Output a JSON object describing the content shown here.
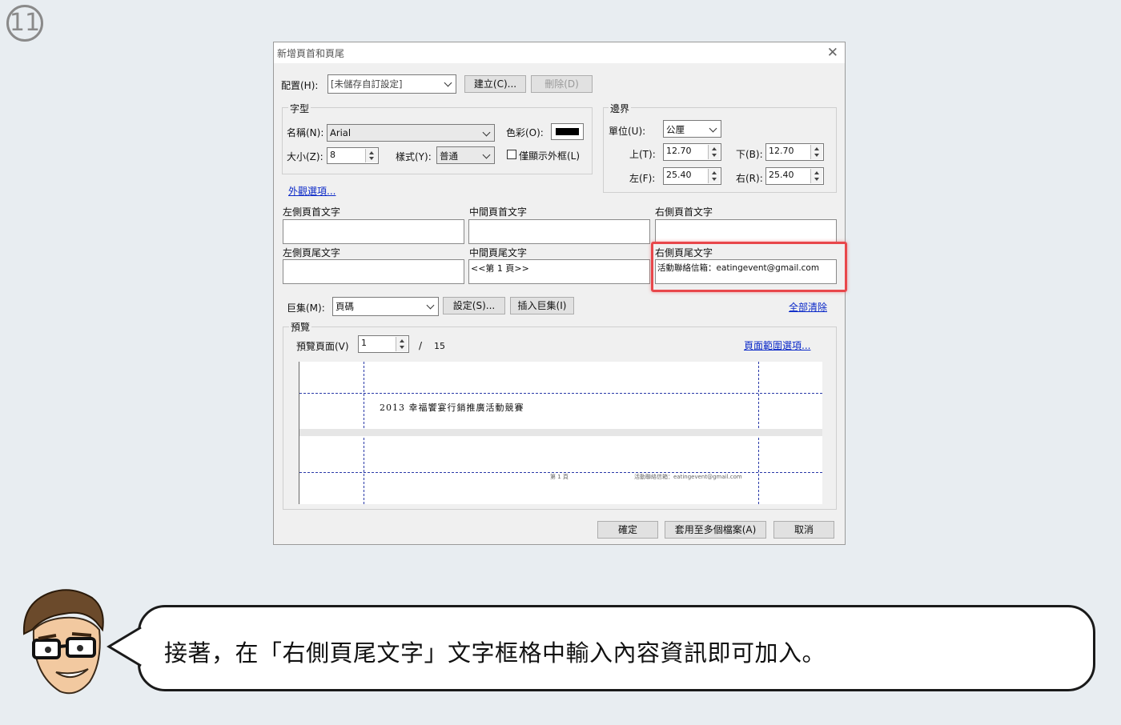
{
  "step": {
    "number": "11"
  },
  "dialog": {
    "title": "新增頁首和頁尾",
    "close": "✕",
    "layout_label": "配置(H):",
    "layout_value": "[未儲存自訂設定]",
    "create_button": "建立(C)...",
    "delete_button": "刪除(D)",
    "font": {
      "group_label": "字型",
      "name_label": "名稱(N):",
      "name_value": "Arial",
      "color_label": "色彩(O):",
      "size_label": "大小(Z):",
      "size_value": "8",
      "style_label": "樣式(Y):",
      "style_value": "普通",
      "outline_checkbox": "僅顯示外框(L)",
      "color_value": "#000000"
    },
    "appearance_link": "外觀選項...",
    "margins": {
      "group_label": "邊界",
      "unit_label": "單位(U):",
      "unit_value": "公厘",
      "top_label": "上(T):",
      "top_value": "12.70",
      "bottom_label": "下(B):",
      "bottom_value": "12.70",
      "left_label": "左(F):",
      "left_value": "25.40",
      "right_label": "右(R):",
      "right_value": "25.40"
    },
    "text_fields": {
      "left_header_label": "左側頁首文字",
      "center_header_label": "中間頁首文字",
      "right_header_label": "右側頁首文字",
      "left_footer_label": "左側頁尾文字",
      "center_footer_label": "中間頁尾文字",
      "right_footer_label": "右側頁尾文字",
      "left_header_value": "",
      "center_header_value": "",
      "right_header_value": "",
      "left_footer_value": "",
      "center_footer_value": "<<第 1 頁>>",
      "right_footer_value": "活動聯絡信箱：eatingevent@gmail.com"
    },
    "macro": {
      "label": "巨集(M):",
      "value": "頁碼",
      "settings_button": "設定(S)...",
      "insert_button": "插入巨集(I)",
      "clear_all_link": "全部清除"
    },
    "preview": {
      "group_label": "預覽",
      "page_label": "預覽頁面(V)",
      "page_value": "1",
      "separator": "/",
      "total_pages": "15",
      "page_range_link": "頁面範圍選項...",
      "doc_title": "2013 幸福饗宴行銷推廣活動競賽",
      "footer_center": "第 1 頁",
      "footer_right": "活動聯絡信箱：eatingevent@gmail.com"
    },
    "ok_button": "確定",
    "apply_multiple_button": "套用至多個檔案(A)",
    "cancel_button": "取消"
  },
  "instruction": {
    "text": "接著，在「右側頁尾文字」文字框格中輸入內容資訊即可加入。"
  },
  "colors": {
    "highlight": "#e8474b",
    "link": "#0a28c8"
  }
}
